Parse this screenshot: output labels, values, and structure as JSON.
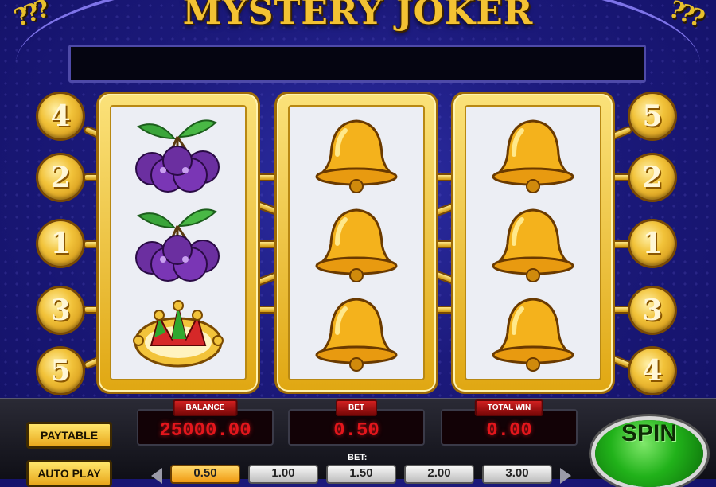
{
  "game": {
    "title": "MYSTERY JOKER"
  },
  "paylines": {
    "left": [
      "4",
      "2",
      "1",
      "3",
      "5"
    ],
    "right": [
      "5",
      "2",
      "1",
      "3",
      "4"
    ]
  },
  "reels": [
    {
      "symbols": [
        "plum",
        "plum",
        "joker-hat"
      ]
    },
    {
      "symbols": [
        "bell",
        "bell",
        "bell"
      ]
    },
    {
      "symbols": [
        "bell",
        "bell",
        "bell"
      ]
    }
  ],
  "meters": {
    "balance": {
      "label": "BALANCE",
      "value": "25000.00"
    },
    "bet": {
      "label": "BET",
      "value": "0.50"
    },
    "total_win": {
      "label": "TOTAL WIN",
      "value": "0.00"
    }
  },
  "buttons": {
    "paytable": "PAYTABLE",
    "autoplay": "AUTO PLAY",
    "spin": "SPIN"
  },
  "bet_selector": {
    "label": "BET:",
    "options": [
      "0.50",
      "1.00",
      "1.50",
      "2.00",
      "3.00"
    ],
    "selected": "0.50"
  },
  "colors": {
    "background": "#1c1a7c",
    "gold": "#f2c33a",
    "meter_text": "#e3161c",
    "spin_button": "#21b21a"
  }
}
